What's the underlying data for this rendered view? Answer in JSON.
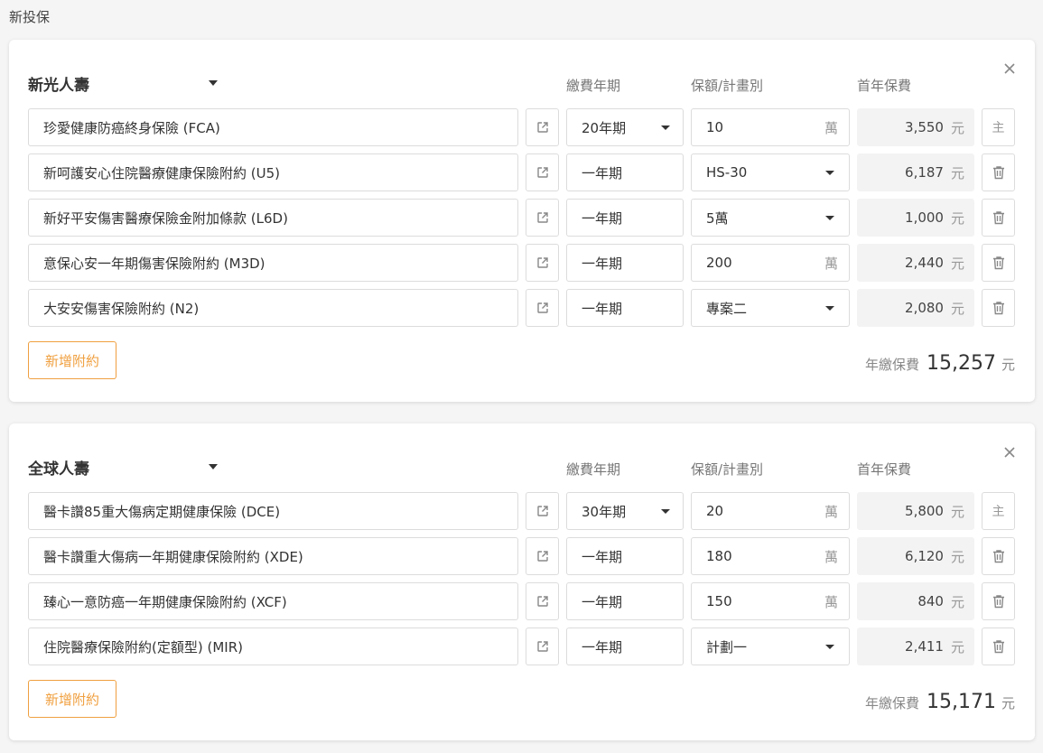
{
  "page": {
    "title": "新投保"
  },
  "labels": {
    "term": "繳費年期",
    "amount": "保額/計畫別",
    "premium": "首年保費",
    "add_rider": "新增附約",
    "annual_premium": "年繳保費",
    "yuan": "元",
    "main_badge": "主"
  },
  "cards": [
    {
      "company": "新光人壽",
      "total": "15,257",
      "rows": [
        {
          "product": "珍愛健康防癌終身保險 (FCA)",
          "term": "20年期",
          "term_dropdown": true,
          "amount": "10",
          "amount_unit": "萬",
          "amount_dropdown": false,
          "premium": "3,550",
          "action": "main"
        },
        {
          "product": "新呵護安心住院醫療健康保險附約 (U5)",
          "term": "一年期",
          "term_dropdown": false,
          "amount": "HS-30",
          "amount_unit": "",
          "amount_dropdown": true,
          "premium": "6,187",
          "action": "trash"
        },
        {
          "product": "新好平安傷害醫療保險金附加條款 (L6D)",
          "term": "一年期",
          "term_dropdown": false,
          "amount": "5萬",
          "amount_unit": "",
          "amount_dropdown": true,
          "premium": "1,000",
          "action": "trash"
        },
        {
          "product": "意保心安一年期傷害保險附約 (M3D)",
          "term": "一年期",
          "term_dropdown": false,
          "amount": "200",
          "amount_unit": "萬",
          "amount_dropdown": false,
          "premium": "2,440",
          "action": "trash"
        },
        {
          "product": "大安安傷害保險附約 (N2)",
          "term": "一年期",
          "term_dropdown": false,
          "amount": "專案二",
          "amount_unit": "",
          "amount_dropdown": true,
          "premium": "2,080",
          "action": "trash"
        }
      ]
    },
    {
      "company": "全球人壽",
      "total": "15,171",
      "rows": [
        {
          "product": "醫卡讚85重大傷病定期健康保險 (DCE)",
          "term": "30年期",
          "term_dropdown": true,
          "amount": "20",
          "amount_unit": "萬",
          "amount_dropdown": false,
          "premium": "5,800",
          "action": "main"
        },
        {
          "product": "醫卡讚重大傷病一年期健康保險附約 (XDE)",
          "term": "一年期",
          "term_dropdown": false,
          "amount": "180",
          "amount_unit": "萬",
          "amount_dropdown": false,
          "premium": "6,120",
          "action": "trash"
        },
        {
          "product": "臻心一意防癌一年期健康保險附約 (XCF)",
          "term": "一年期",
          "term_dropdown": false,
          "amount": "150",
          "amount_unit": "萬",
          "amount_dropdown": false,
          "premium": "840",
          "action": "trash"
        },
        {
          "product": "住院醫療保險附約(定額型) (MIR)",
          "term": "一年期",
          "term_dropdown": false,
          "amount": "計劃一",
          "amount_unit": "",
          "amount_dropdown": true,
          "premium": "2,411",
          "action": "trash"
        }
      ]
    }
  ]
}
